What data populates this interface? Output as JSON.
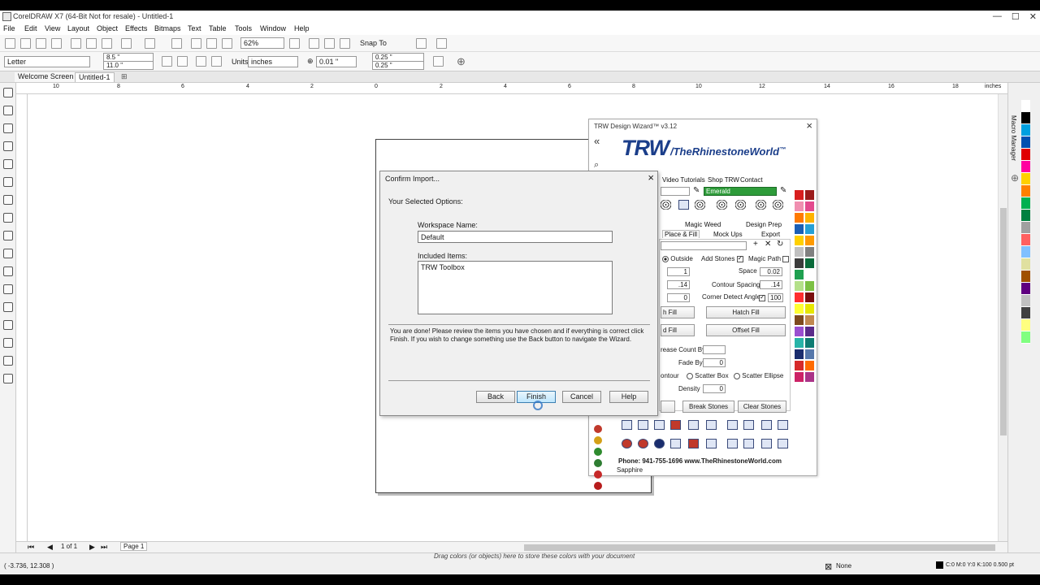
{
  "window": {
    "title": "CorelDRAW X7 (64-Bit Not for resale) - Untitled-1"
  },
  "menu": [
    "File",
    "Edit",
    "View",
    "Layout",
    "Object",
    "Effects",
    "Bitmaps",
    "Text",
    "Table",
    "Tools",
    "Window",
    "Help"
  ],
  "toolbar": {
    "zoom": "62%",
    "snap_to": "Snap To"
  },
  "property_bar": {
    "paper_size": "Letter",
    "width": "8.5 \"",
    "height": "11.0 \"",
    "units_label": "Units:",
    "units_value": "inches",
    "nudge": "0.01 \"",
    "dup_x": "0.25 \"",
    "dup_y": "0.25 \""
  },
  "doc_tabs": [
    "Welcome Screen",
    "Untitled-1"
  ],
  "ruler_ticks": [
    "10",
    "8",
    "6",
    "4",
    "2",
    "0",
    "2",
    "4",
    "6",
    "8",
    "10",
    "12",
    "14",
    "16",
    "18",
    "inches"
  ],
  "dialog": {
    "title": "Confirm Import...",
    "section": "Your Selected Options:",
    "workspace_label": "Workspace Name:",
    "workspace_value": "Default",
    "included_label": "Included Items:",
    "included_value": "TRW Toolbox",
    "info": "You are done! Please review the items you have chosen and if everything is correct click Finish. If you wish to change something use the Back button to navigate the Wizard.",
    "buttons": {
      "back": "Back",
      "finish": "Finish",
      "cancel": "Cancel",
      "help": "Help"
    }
  },
  "trw": {
    "title": "TRW Design Wizard™ v3.12",
    "logo_big": "TRW",
    "logo_small": "/TheRhinestoneWorld",
    "logo_tm": "™",
    "tabs_top": [
      "Video Tutorials",
      "Shop TRW",
      "Contact"
    ],
    "color_select": "Emerald",
    "tabs_mid": [
      "Magic Weed",
      "Design Prep"
    ],
    "tabs_low": [
      "Place & Fill",
      "Mock Ups",
      "Export"
    ],
    "outside": "Outside",
    "add_stones": "Add Stones",
    "magic_path": "Magic Path",
    "space_label": "Space",
    "space_value": "0.02",
    "contour_spacing_label": "Contour Spacing",
    "contour_spacing_value": ".14",
    "corner_label": "Corner Detect Angle",
    "corner_value": "100",
    "field_1": "1",
    "field_14": ".14",
    "field_0": "0",
    "hatch_fill": "Hatch Fill",
    "offset_fill": "Offset Fill",
    "fill_partial_1": "h Fill",
    "fill_partial_2": "d Fill",
    "increase_count": "rease Count By",
    "fade_by": "Fade By",
    "fade_value": "0",
    "contour_partial": "ontour",
    "scatter_box": "Scatter Box",
    "scatter_ellipse": "Scatter Ellipse",
    "density_label": "Density",
    "density_value": "0",
    "break_stones": "Break Stones",
    "clear_stones": "Clear Stones",
    "phone": "Phone: 941-755-1696  www.TheRhinestoneWorld.com",
    "footer_color": "Sapphire",
    "colors": [
      "#d81e1e",
      "#9b1b1b",
      "#f08fb0",
      "#e34a8e",
      "#ff7a00",
      "#ffb300",
      "#1c5fb5",
      "#26a0d6",
      "#ffd000",
      "#ff9a00",
      "#c0c0c0",
      "#808080",
      "#3c3c3c",
      "#0a6b3a",
      "#1fa050",
      "#ffffff",
      "#b4e08a",
      "#7bc043",
      "#ff2e2e",
      "#7a0e0e",
      "#ffff33",
      "#e6e600",
      "#7d4a1f",
      "#c08850",
      "#9a4fd0",
      "#5a2b8a",
      "#28b4a8",
      "#0e7c72",
      "#1a2d6e",
      "#5577aa",
      "#d62a2a",
      "#ff6b00",
      "#cc2266",
      "#aa3388"
    ],
    "ball_colors": [
      "#c0392b",
      "#d4a017",
      "#2e8b2e",
      "#2e7d32",
      "#c62828",
      "#b71c1c"
    ]
  },
  "palette": [
    "#ffffff",
    "#000000",
    "#00a0e0",
    "#0050b0",
    "#e00000",
    "#ff00a0",
    "#ffd000",
    "#ff8000",
    "#00b050",
    "#008040",
    "#a0a0a0",
    "#ff6060",
    "#80c0ff",
    "#e0e0a0",
    "#a05000",
    "#600080",
    "#c0c0c0",
    "#404040",
    "#ffff80",
    "#80ff80"
  ],
  "page_nav": {
    "count": "1 of 1",
    "page_tab": "Page 1"
  },
  "status": {
    "coords": "( -3.736, 12.308 )",
    "hint": "Drag colors (or objects) here to store these colors with your document",
    "fill": "None",
    "outline": "C:0 M:0 Y:0 K:100  0.500 pt"
  },
  "side_docker": "Macro Manager"
}
